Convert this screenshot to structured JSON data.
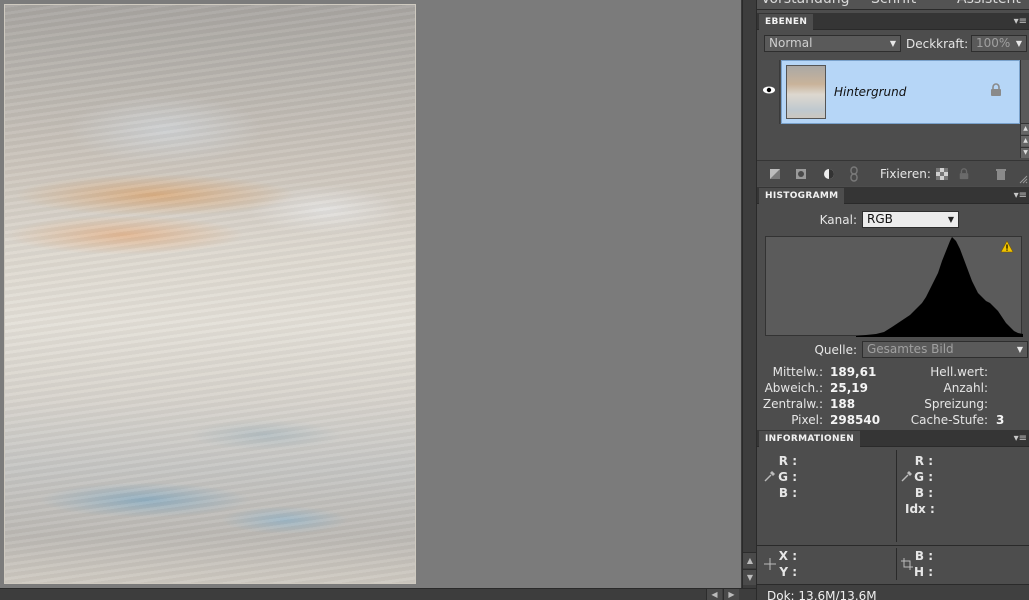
{
  "top_tabs": [
    "Vorstandung",
    "Schrift",
    "Assistent"
  ],
  "layers_panel": {
    "title": "EBENEN",
    "blend_mode": "Normal",
    "opacity_label": "Deckkraft:",
    "opacity_value": "100%",
    "layers": [
      {
        "name": "Hintergrund",
        "visible": true,
        "locked": true
      }
    ],
    "fixieren_label": "Fixieren:"
  },
  "histogram_panel": {
    "title": "HISTOGRAMM",
    "channel_label": "Kanal:",
    "channel_value": "RGB",
    "source_label": "Quelle:",
    "source_value": "Gesamtes Bild",
    "stats": {
      "mean_label": "Mittelw.:",
      "mean": "189,61",
      "stddev_label": "Abweich.:",
      "stddev": "25,19",
      "median_label": "Zentralw.:",
      "median": "188",
      "pixels_label": "Pixel:",
      "pixels": "298540",
      "level_label": "Hell.wert:",
      "count_label": "Anzahl:",
      "percentile_label": "Spreizung:",
      "cache_label": "Cache-Stufe:",
      "cache": "3"
    },
    "warning_icon": "warning-triangle-icon"
  },
  "info_panel": {
    "title": "INFORMATIONEN",
    "left_rgb": [
      "R :",
      "G :",
      "B :"
    ],
    "right_rgb": [
      "R :",
      "G :",
      "B :",
      "Idx :"
    ],
    "xy": [
      "X :",
      "Y :"
    ],
    "bh": [
      "B :",
      "H :"
    ]
  },
  "status": {
    "doc": "Dok: 13,6M/13,6M"
  },
  "colors": {
    "selection": "#b6d6f7",
    "panel_bg": "#4d4d4d",
    "header_bg": "#353535",
    "canvas_bg": "#7b7b7b"
  }
}
